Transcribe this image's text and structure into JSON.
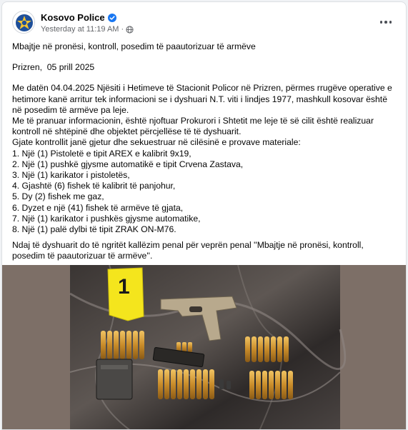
{
  "post": {
    "author": "Kosovo Police",
    "timestamp": "Yesterday at 11:19 AM",
    "separator": "·",
    "audience_icon": "globe-icon",
    "verified_icon": "verified-badge-icon",
    "more_icon": "more-options-icon",
    "title": "Mbajtje në pronësi, kontroll, posedim të paautorizuar të armëve",
    "dateline": "Prizren,  05 prill 2025",
    "paragraph1": "Me datën 04.04.2025 Njësiti i Hetimeve të Stacionit Policor në Prizren, përmes rrugëve operative e hetimore kanë arritur tek informacioni se i dyshuari N.T. viti i lindjes 1977, mashkull kosovar është në posedim të armëve pa leje.",
    "paragraph2": "Me të pranuar informacionin, është njoftuar Prokurori i Shtetit me leje të së cilit është realizuar kontroll në shtëpinë dhe objektet përcjellëse të të dyshuarit.",
    "list_intro": "Gjate kontrollit janë gjetur dhe sekuestruar në cilësinë e provave materiale:",
    "items": [
      "1. Një (1) Pistoletë e tipit AREX e kalibrit 9x19,",
      "2. Një (1) pushkë gjysme automatikë e tipit Crvena Zastava,",
      "3. Një (1) karikator i pistoletës,",
      "4. Gjashtë (6) fishek të kalibrit të panjohur,",
      "5. Dy (2) fishek me gaz,",
      "6. Dyzet e një (41) fishek të armëve të gjata,",
      "7. Një (1) karikator i pushkës gjysme automatike,",
      "8. Një (1) palë dylbi të tipit ZRAK ON-M76."
    ],
    "closing": "Ndaj të dyshuarit do të ngritët kallëzim penal për veprën penal ''Mbajtje në pronësi, kontroll, posedim të paautorizuar të armëve''.",
    "photo_marker": "1"
  }
}
